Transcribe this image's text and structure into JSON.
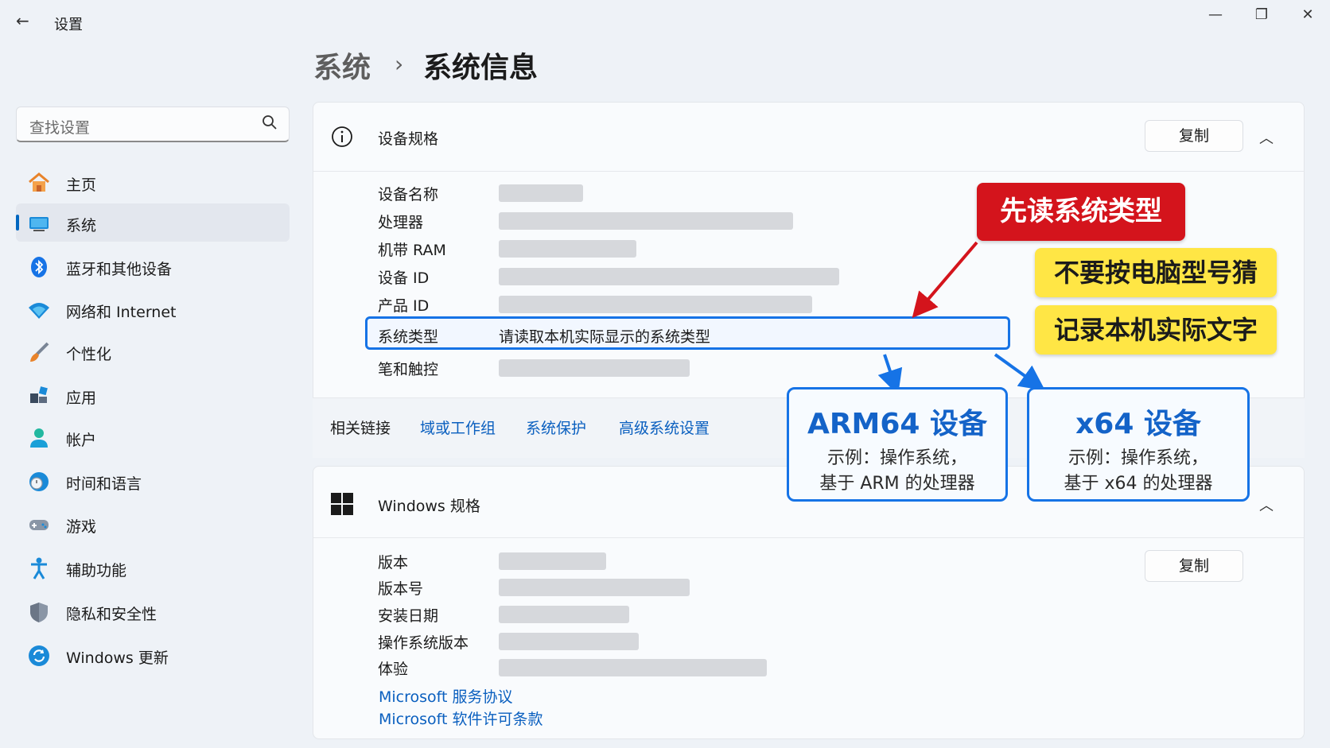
{
  "window": {
    "title": "设置",
    "back_icon": "←",
    "minimize_icon": "—",
    "restore_icon": "❐",
    "close_icon": "✕"
  },
  "breadcrumb": {
    "parent": "系统",
    "separator": "›",
    "current": "系统信息"
  },
  "search": {
    "placeholder": "查找设置"
  },
  "sidebar": {
    "items": [
      {
        "label": "主页",
        "icon": "home-icon",
        "active": false
      },
      {
        "label": "系统",
        "icon": "system-icon",
        "active": true
      },
      {
        "label": "蓝牙和其他设备",
        "icon": "bluetooth-icon",
        "active": false
      },
      {
        "label": "网络和 Internet",
        "icon": "wifi-icon",
        "active": false
      },
      {
        "label": "个性化",
        "icon": "brush-icon",
        "active": false
      },
      {
        "label": "应用",
        "icon": "apps-icon",
        "active": false
      },
      {
        "label": "帐户",
        "icon": "account-icon",
        "active": false
      },
      {
        "label": "时间和语言",
        "icon": "time-language-icon",
        "active": false
      },
      {
        "label": "游戏",
        "icon": "gamepad-icon",
        "active": false
      },
      {
        "label": "辅助功能",
        "icon": "accessibility-icon",
        "active": false
      },
      {
        "label": "隐私和安全性",
        "icon": "shield-icon",
        "active": false
      },
      {
        "label": "Windows 更新",
        "icon": "update-icon",
        "active": false
      }
    ]
  },
  "device_specs": {
    "title": "设备规格",
    "copy_label": "复制",
    "collapse_icon": "︿",
    "rows": [
      {
        "label": "设备名称"
      },
      {
        "label": "处理器"
      },
      {
        "label": "机带 RAM"
      },
      {
        "label": "设备 ID"
      },
      {
        "label": "产品 ID"
      }
    ],
    "highlight": {
      "label": "系统类型",
      "value": "请读取本机实际显示的系统类型"
    },
    "last_row": {
      "label": "笔和触控"
    },
    "related": {
      "label": "相关链接",
      "links": [
        "域或工作组",
        "系统保护",
        "高级系统设置"
      ]
    }
  },
  "windows_specs": {
    "title": "Windows 规格",
    "copy_label": "复制",
    "collapse_icon": "︿",
    "rows": [
      {
        "label": "版本"
      },
      {
        "label": "版本号"
      },
      {
        "label": "安装日期"
      },
      {
        "label": "操作系统版本"
      },
      {
        "label": "体验"
      }
    ],
    "links": [
      "Microsoft 服务协议",
      "Microsoft 软件许可条款"
    ]
  },
  "annotations": {
    "red_tag": "先读系统类型",
    "yellow_tags": [
      "不要按电脑型号猜",
      "记录本机实际文字"
    ],
    "arm64": {
      "title": "ARM64 设备",
      "line1": "示例：操作系统，",
      "line2": "基于 ARM 的处理器"
    },
    "x64": {
      "title": "x64 设备",
      "line1": "示例：操作系统，",
      "line2": "基于 x64 的处理器"
    },
    "colors": {
      "red": "#d4141c",
      "yellow": "#ffe645",
      "blue": "#1673e6"
    }
  }
}
